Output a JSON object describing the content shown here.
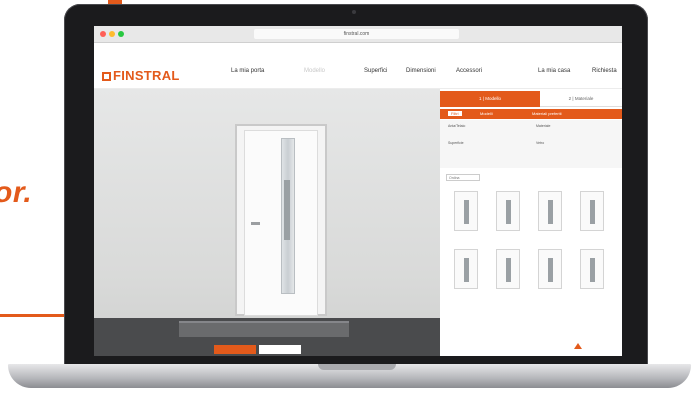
{
  "background": {
    "headline_fragment": "or.",
    "accent_color": "#e35a1b"
  },
  "browser": {
    "url": "finstral.com"
  },
  "site": {
    "logo_text": "FINSTRAL",
    "top_links": "",
    "nav": [
      {
        "label": "La mia porta",
        "sub": "",
        "disabled": false
      },
      {
        "label": "Modello",
        "sub": "",
        "disabled": true
      },
      {
        "label": "Superfici",
        "sub": "",
        "disabled": false
      },
      {
        "label": "Dimensioni",
        "sub": "",
        "disabled": false
      },
      {
        "label": "Accessori",
        "sub": "",
        "disabled": false
      },
      {
        "label": "La mia casa",
        "sub": "",
        "disabled": false
      },
      {
        "label": "Richiesta",
        "sub": "",
        "disabled": false
      }
    ]
  },
  "panel": {
    "tab_active": "1 | Modello",
    "tab_inactive": "2 | Materiale",
    "subtabs": [
      "Filtri",
      "Modelli",
      "Materiali preferiti"
    ],
    "filter_labels": [
      "Anta/Telaio",
      "Materiale",
      "Superficie",
      "Vetro"
    ],
    "sort_label": "Ordina"
  },
  "stage": {
    "button_primary": "",
    "button_secondary": ""
  }
}
